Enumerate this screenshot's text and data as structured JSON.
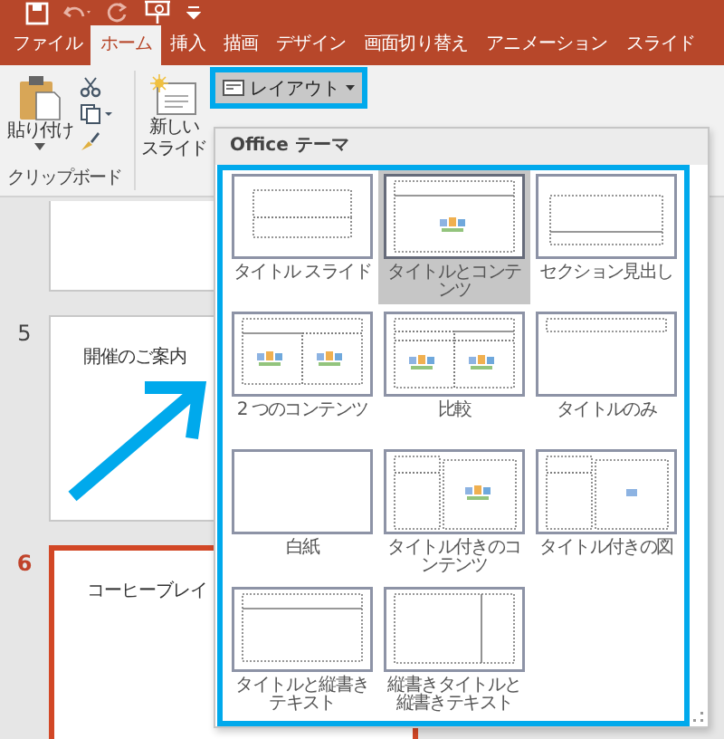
{
  "tabs": [
    {
      "label": "ファイル",
      "selected": false
    },
    {
      "label": "ホーム",
      "selected": true
    },
    {
      "label": "挿入",
      "selected": false
    },
    {
      "label": "描画",
      "selected": false
    },
    {
      "label": "デザイン",
      "selected": false
    },
    {
      "label": "画面切り替え",
      "selected": false
    },
    {
      "label": "アニメーション",
      "selected": false
    },
    {
      "label": "スライド",
      "selected": false
    }
  ],
  "ribbon": {
    "paste_label": "貼り付け",
    "clipboard_group": "クリップボード",
    "new_slide_label": [
      "新しい",
      "スライド"
    ],
    "layout_button": {
      "label": "レイアウト",
      "highlighted": true
    }
  },
  "slides": [
    {
      "selected": false
    },
    {
      "number": "5",
      "title": "開催のご案内",
      "selected": false
    },
    {
      "number": "6",
      "title": "コーヒーブレイ",
      "selected": true
    }
  ],
  "layout_menu": {
    "header": "Office テーマ",
    "highlighted": true,
    "layouts": [
      {
        "label": "タイトル スライド",
        "kind": "title_slide",
        "selected": false
      },
      {
        "label": "タイトルとコンテンツ",
        "kind": "title_content",
        "selected": true
      },
      {
        "label": "セクション見出し",
        "kind": "section",
        "selected": false
      },
      {
        "label": "2 つのコンテンツ",
        "kind": "two_content",
        "selected": false
      },
      {
        "label": "比較",
        "kind": "comparison",
        "selected": false
      },
      {
        "label": "タイトルのみ",
        "kind": "title_only",
        "selected": false
      },
      {
        "label": "白紙",
        "kind": "blank",
        "selected": false
      },
      {
        "label": "タイトル付きのコンテンツ",
        "kind": "content_caption",
        "selected": false
      },
      {
        "label": "タイトル付きの図",
        "kind": "picture_caption",
        "selected": false
      },
      {
        "label": "タイトルと縦書きテキスト",
        "kind": "vertical_text",
        "selected": false
      },
      {
        "label": "縦書きタイトルと縦書きテキスト",
        "kind": "vertical_title",
        "selected": false
      }
    ]
  }
}
